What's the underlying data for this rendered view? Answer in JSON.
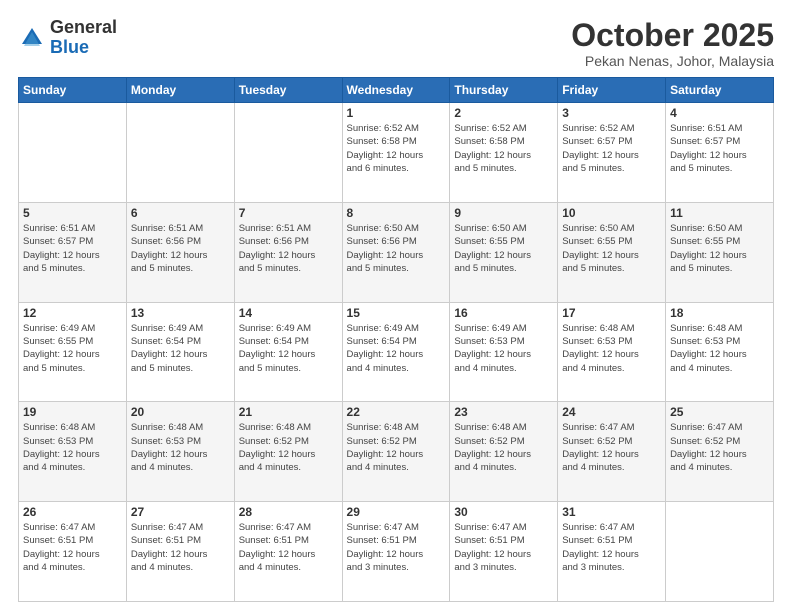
{
  "logo": {
    "general": "General",
    "blue": "Blue"
  },
  "header": {
    "month": "October 2025",
    "location": "Pekan Nenas, Johor, Malaysia"
  },
  "weekdays": [
    "Sunday",
    "Monday",
    "Tuesday",
    "Wednesday",
    "Thursday",
    "Friday",
    "Saturday"
  ],
  "weeks": [
    [
      {
        "day": "",
        "info": ""
      },
      {
        "day": "",
        "info": ""
      },
      {
        "day": "",
        "info": ""
      },
      {
        "day": "1",
        "info": "Sunrise: 6:52 AM\nSunset: 6:58 PM\nDaylight: 12 hours\nand 6 minutes."
      },
      {
        "day": "2",
        "info": "Sunrise: 6:52 AM\nSunset: 6:58 PM\nDaylight: 12 hours\nand 5 minutes."
      },
      {
        "day": "3",
        "info": "Sunrise: 6:52 AM\nSunset: 6:57 PM\nDaylight: 12 hours\nand 5 minutes."
      },
      {
        "day": "4",
        "info": "Sunrise: 6:51 AM\nSunset: 6:57 PM\nDaylight: 12 hours\nand 5 minutes."
      }
    ],
    [
      {
        "day": "5",
        "info": "Sunrise: 6:51 AM\nSunset: 6:57 PM\nDaylight: 12 hours\nand 5 minutes."
      },
      {
        "day": "6",
        "info": "Sunrise: 6:51 AM\nSunset: 6:56 PM\nDaylight: 12 hours\nand 5 minutes."
      },
      {
        "day": "7",
        "info": "Sunrise: 6:51 AM\nSunset: 6:56 PM\nDaylight: 12 hours\nand 5 minutes."
      },
      {
        "day": "8",
        "info": "Sunrise: 6:50 AM\nSunset: 6:56 PM\nDaylight: 12 hours\nand 5 minutes."
      },
      {
        "day": "9",
        "info": "Sunrise: 6:50 AM\nSunset: 6:55 PM\nDaylight: 12 hours\nand 5 minutes."
      },
      {
        "day": "10",
        "info": "Sunrise: 6:50 AM\nSunset: 6:55 PM\nDaylight: 12 hours\nand 5 minutes."
      },
      {
        "day": "11",
        "info": "Sunrise: 6:50 AM\nSunset: 6:55 PM\nDaylight: 12 hours\nand 5 minutes."
      }
    ],
    [
      {
        "day": "12",
        "info": "Sunrise: 6:49 AM\nSunset: 6:55 PM\nDaylight: 12 hours\nand 5 minutes."
      },
      {
        "day": "13",
        "info": "Sunrise: 6:49 AM\nSunset: 6:54 PM\nDaylight: 12 hours\nand 5 minutes."
      },
      {
        "day": "14",
        "info": "Sunrise: 6:49 AM\nSunset: 6:54 PM\nDaylight: 12 hours\nand 5 minutes."
      },
      {
        "day": "15",
        "info": "Sunrise: 6:49 AM\nSunset: 6:54 PM\nDaylight: 12 hours\nand 4 minutes."
      },
      {
        "day": "16",
        "info": "Sunrise: 6:49 AM\nSunset: 6:53 PM\nDaylight: 12 hours\nand 4 minutes."
      },
      {
        "day": "17",
        "info": "Sunrise: 6:48 AM\nSunset: 6:53 PM\nDaylight: 12 hours\nand 4 minutes."
      },
      {
        "day": "18",
        "info": "Sunrise: 6:48 AM\nSunset: 6:53 PM\nDaylight: 12 hours\nand 4 minutes."
      }
    ],
    [
      {
        "day": "19",
        "info": "Sunrise: 6:48 AM\nSunset: 6:53 PM\nDaylight: 12 hours\nand 4 minutes."
      },
      {
        "day": "20",
        "info": "Sunrise: 6:48 AM\nSunset: 6:53 PM\nDaylight: 12 hours\nand 4 minutes."
      },
      {
        "day": "21",
        "info": "Sunrise: 6:48 AM\nSunset: 6:52 PM\nDaylight: 12 hours\nand 4 minutes."
      },
      {
        "day": "22",
        "info": "Sunrise: 6:48 AM\nSunset: 6:52 PM\nDaylight: 12 hours\nand 4 minutes."
      },
      {
        "day": "23",
        "info": "Sunrise: 6:48 AM\nSunset: 6:52 PM\nDaylight: 12 hours\nand 4 minutes."
      },
      {
        "day": "24",
        "info": "Sunrise: 6:47 AM\nSunset: 6:52 PM\nDaylight: 12 hours\nand 4 minutes."
      },
      {
        "day": "25",
        "info": "Sunrise: 6:47 AM\nSunset: 6:52 PM\nDaylight: 12 hours\nand 4 minutes."
      }
    ],
    [
      {
        "day": "26",
        "info": "Sunrise: 6:47 AM\nSunset: 6:51 PM\nDaylight: 12 hours\nand 4 minutes."
      },
      {
        "day": "27",
        "info": "Sunrise: 6:47 AM\nSunset: 6:51 PM\nDaylight: 12 hours\nand 4 minutes."
      },
      {
        "day": "28",
        "info": "Sunrise: 6:47 AM\nSunset: 6:51 PM\nDaylight: 12 hours\nand 4 minutes."
      },
      {
        "day": "29",
        "info": "Sunrise: 6:47 AM\nSunset: 6:51 PM\nDaylight: 12 hours\nand 3 minutes."
      },
      {
        "day": "30",
        "info": "Sunrise: 6:47 AM\nSunset: 6:51 PM\nDaylight: 12 hours\nand 3 minutes."
      },
      {
        "day": "31",
        "info": "Sunrise: 6:47 AM\nSunset: 6:51 PM\nDaylight: 12 hours\nand 3 minutes."
      },
      {
        "day": "",
        "info": ""
      }
    ]
  ]
}
